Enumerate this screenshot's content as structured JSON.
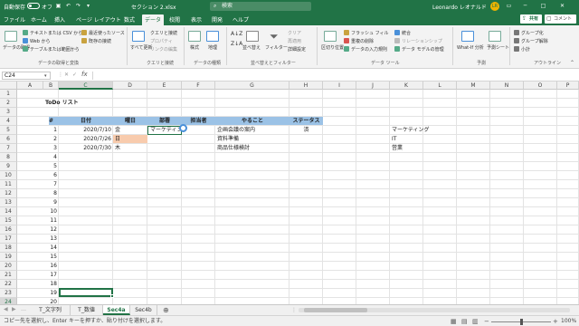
{
  "titlebar": {
    "autosave_label": "自動保存",
    "autosave_state": "オフ",
    "file_title": "セクション 2.xlsx",
    "search_placeholder": "検索",
    "user_name": "Leonardo レオナルド",
    "user_initials": "LR"
  },
  "menu": {
    "tabs": [
      "ファイル",
      "ホーム",
      "挿入",
      "ページ レイアウト",
      "数式",
      "データ",
      "校閲",
      "表示",
      "開発",
      "ヘルプ"
    ],
    "active_tab": "データ",
    "share_label": "共有",
    "comment_label": "コメント"
  },
  "ribbon": {
    "get_data": "データの取得",
    "text_csv": "テキストまたは CSV から",
    "web": "Web から",
    "table_range": "テーブルまたは範囲から",
    "recent_sources": "最近使ったソース",
    "existing_connections": "既存の接続",
    "group_get": "データの取得と変換",
    "refresh_all": "すべて更新",
    "queries_connections": "クエリと接続",
    "properties": "プロパティ",
    "edit_links": "リンクの編集",
    "group_queries": "クエリと接続",
    "stocks": "株式",
    "geography": "地理",
    "group_datatypes": "データの種類",
    "sort": "並べ替え",
    "filter": "フィルター",
    "clear": "クリア",
    "reapply": "再適用",
    "advanced": "詳細設定",
    "group_sortfilter": "並べ替えとフィルター",
    "text_to_columns": "区切り位置",
    "flash_fill": "フラッシュ フィル",
    "remove_duplicates": "重複の削除",
    "data_validation": "データの入力規則",
    "consolidate": "統合",
    "relationships": "リレーションシップ",
    "data_model": "データ モデルの管理",
    "group_datatools": "データ ツール",
    "whatif": "What-If 分析",
    "forecast_sheet": "予測シート",
    "group_forecast": "予測",
    "group_btn": "グループ化",
    "ungroup_btn": "グループ解除",
    "subtotal": "小計",
    "group_outline": "アウトライン"
  },
  "formula_bar": {
    "name_box": "C24",
    "formula": ""
  },
  "grid": {
    "columns": [
      "A",
      "B",
      "C",
      "D",
      "E",
      "F",
      "G",
      "H",
      "I",
      "J",
      "K",
      "L",
      "M",
      "N",
      "O",
      "P"
    ],
    "selected_column": "C",
    "rows": [
      "1",
      "2",
      "3",
      "4",
      "5",
      "6",
      "7",
      "8",
      "9",
      "10",
      "11",
      "12",
      "13",
      "14",
      "15",
      "16",
      "17",
      "18",
      "19",
      "20",
      "21",
      "22",
      "23",
      "24",
      "25"
    ],
    "selected_row": "24",
    "title": "ToDo リスト",
    "headers": [
      "#",
      "日付",
      "曜日",
      "部署",
      "担当者",
      "やること",
      "ステータス"
    ],
    "data_rows": [
      {
        "no": "1",
        "date": "2020/7/10",
        "dow": "金",
        "dept": "マーケティング",
        "person": "",
        "task": "企画会議の案内",
        "status": "済"
      },
      {
        "no": "2",
        "date": "2020/7/26",
        "dow": "日",
        "dept": "",
        "person": "",
        "task": "資料準備",
        "status": ""
      },
      {
        "no": "3",
        "date": "2020/7/30",
        "dow": "木",
        "dept": "",
        "person": "",
        "task": "商品仕様検討",
        "status": ""
      }
    ],
    "numbers": [
      "4",
      "5",
      "6",
      "7",
      "8",
      "9",
      "10",
      "11",
      "12",
      "13",
      "14",
      "15",
      "16",
      "17",
      "18",
      "19",
      "20"
    ],
    "dept_list": [
      "マーケティング",
      "IT",
      "営業"
    ]
  },
  "sheets": {
    "tabs": [
      "T_文字列",
      "T_数値",
      "Sec4a",
      "Sec4b"
    ],
    "active": "Sec4a"
  },
  "status": {
    "message": "コピー先を選択し、Enter キーを押すか、貼り付けを選択します。",
    "zoom": "100%"
  },
  "colors": {
    "brand": "#217346",
    "header_fill": "#9bc2e6",
    "weekend_fill": "#f8cbad",
    "selection": "#217346"
  }
}
